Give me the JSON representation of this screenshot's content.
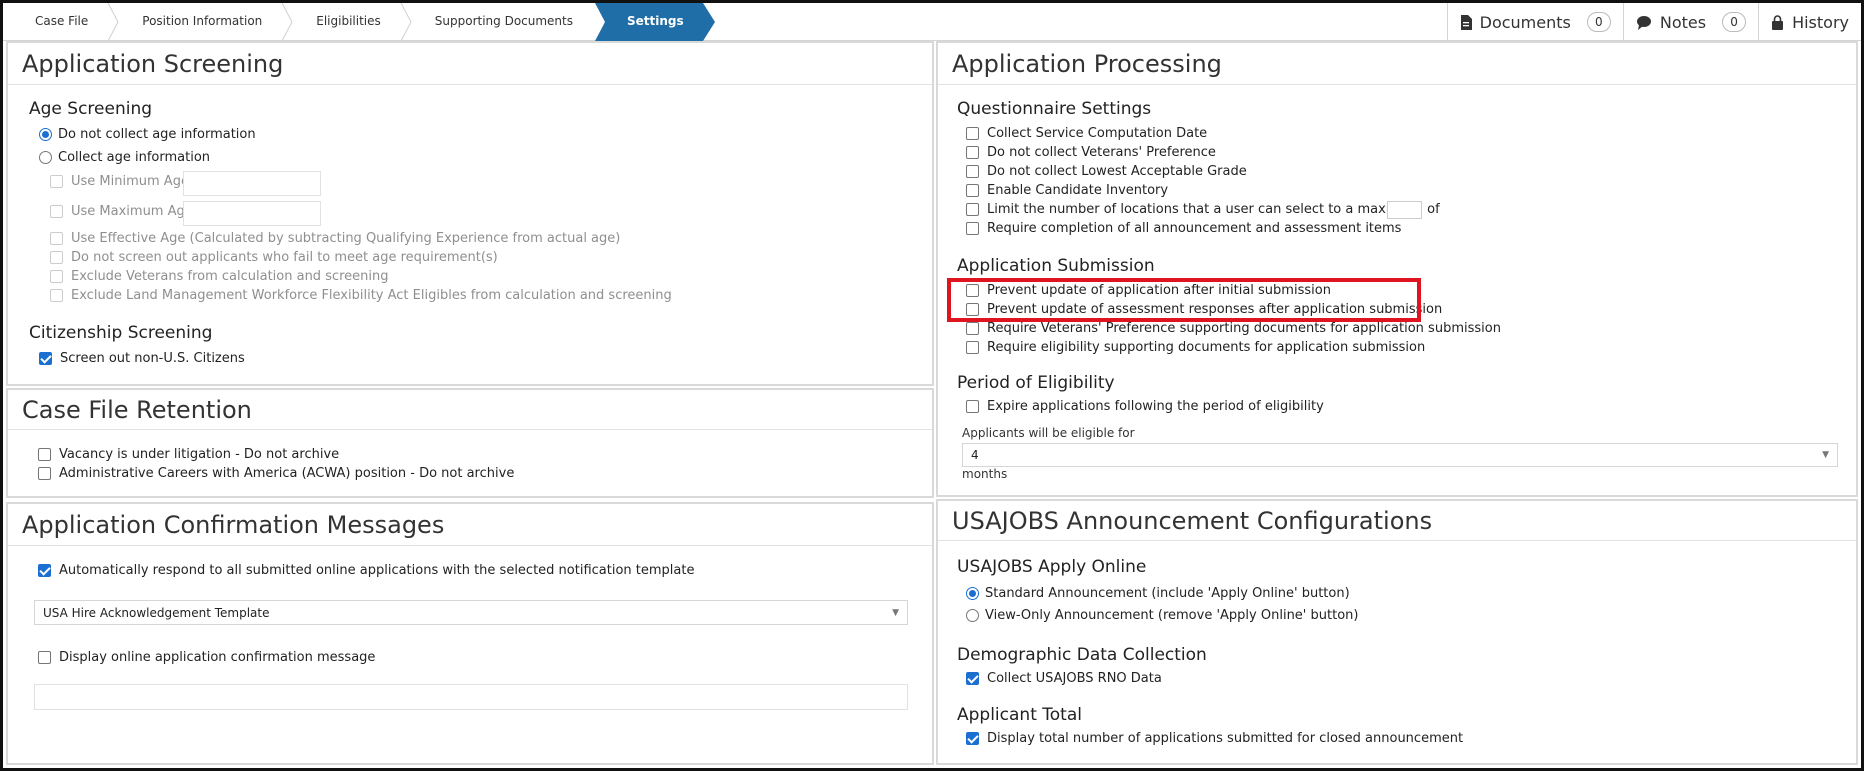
{
  "breadcrumbs": [
    "Case File",
    "Position Information",
    "Eligibilities",
    "Supporting Documents",
    "Settings"
  ],
  "top_links": {
    "documents": {
      "label": "Documents",
      "count": "0"
    },
    "notes": {
      "label": "Notes",
      "count": "0"
    },
    "history": {
      "label": "History"
    }
  },
  "colors": {
    "accent": "#1f6ea8",
    "highlight": "#e0141e"
  },
  "app_screening": {
    "title": "Application Screening",
    "age_heading": "Age Screening",
    "radio_no_collect": "Do not collect age information",
    "radio_collect": "Collect age information",
    "use_min_age": "Use Minimum Age",
    "use_max_age": "Use Maximum Age",
    "use_effective_age": "Use Effective Age (Calculated by subtracting Qualifying Experience from actual age)",
    "no_screen_out": "Do not screen out applicants who fail to meet age requirement(s)",
    "exclude_veterans": "Exclude Veterans from calculation and screening",
    "exclude_land": "Exclude Land Management Workforce Flexibility Act Eligibles from calculation and screening",
    "citizenship_heading": "Citizenship Screening",
    "screen_out_non_us": "Screen out non-U.S. Citizens"
  },
  "case_file_retention": {
    "title": "Case File Retention",
    "litigation": "Vacancy is under litigation - Do not archive",
    "acwa": "Administrative Careers with America (ACWA) position - Do not archive"
  },
  "confirmation": {
    "title": "Application Confirmation Messages",
    "auto_respond": "Automatically respond to all submitted online applications with the selected notification template",
    "template_value": "USA Hire Acknowledgement Template",
    "display_message": "Display online application confirmation message"
  },
  "processing": {
    "title": "Application Processing",
    "questionnaire_heading": "Questionnaire Settings",
    "q_items": [
      "Collect Service Computation Date",
      "Do not collect Veterans' Preference",
      "Do not collect Lowest Acceptable Grade",
      "Enable Candidate Inventory",
      "Limit the number of locations that a user can select to a maximum of",
      "Require completion of all announcement and assessment items"
    ],
    "submission_heading": "Application Submission",
    "s_items": [
      "Prevent update of application after initial submission",
      "Prevent update of assessment responses after application submission",
      "Require Veterans' Preference supporting documents for application submission",
      "Require eligibility supporting documents for application submission"
    ],
    "eligibility_heading": "Period of Eligibility",
    "expire": "Expire applications following the period of eligibility",
    "eligible_for_label": "Applicants will be eligible for",
    "eligible_value": "4",
    "months": "months"
  },
  "usajobs": {
    "title": "USAJOBS Announcement Configurations",
    "apply_heading": "USAJOBS Apply Online",
    "standard": "Standard Announcement (include 'Apply Online' button)",
    "view_only": "View-Only Announcement (remove 'Apply Online' button)",
    "demographic_heading": "Demographic Data Collection",
    "rno": "Collect USAJOBS RNO Data",
    "total_heading": "Applicant Total",
    "display_total": "Display total number of applications submitted for closed announcement"
  }
}
